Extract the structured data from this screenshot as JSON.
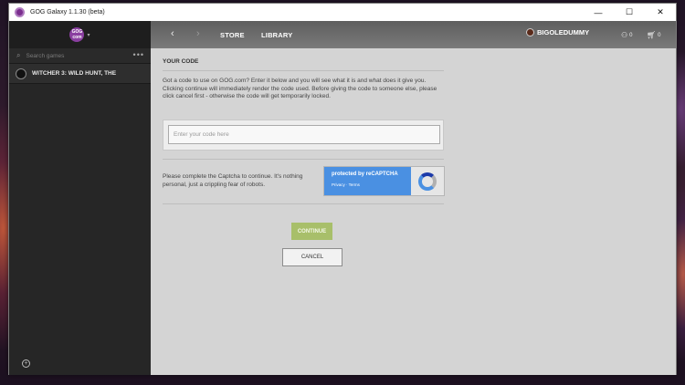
{
  "window": {
    "title": "GOG Galaxy 1.1.30 (beta)",
    "controls": {
      "minimize": "—",
      "maximize": "☐",
      "close": "✕"
    }
  },
  "sidebar": {
    "logo_line1": "GOG",
    "logo_line2": "com",
    "search_placeholder": "Search games",
    "more_label": "•••",
    "games": [
      {
        "title": "WITCHER 3: WILD HUNT, THE"
      }
    ],
    "footer_icon": "add-circle-icon"
  },
  "nav": {
    "back": "‹",
    "forward": "›",
    "store": "STORE",
    "library": "LIBRARY",
    "user": "BIGOLEDUMMY",
    "friends_count": "0",
    "cart_count": "0"
  },
  "code_page": {
    "title": "YOUR CODE",
    "description": "Got a code to use on GOG.com? Enter it below and you will see what it is and what does it give you. Clicking continue will immediately render the code used. Before giving the code to someone else, please click cancel first - otherwise the code will get temporarily locked.",
    "input_placeholder": "Enter your code here",
    "input_value": "",
    "captcha_text": "Please complete the Captcha to continue. It's nothing personal, just a crippling fear of robots.",
    "recaptcha": {
      "label": "protected by reCAPTCHA",
      "links": "Privacy · Terms"
    },
    "continue_label": "CONTINUE",
    "cancel_label": "CANCEL"
  },
  "colors": {
    "accent_green": "#a8bf6a",
    "recaptcha_blue": "#4a90e2",
    "gog_purple": "#8a3fa0"
  }
}
